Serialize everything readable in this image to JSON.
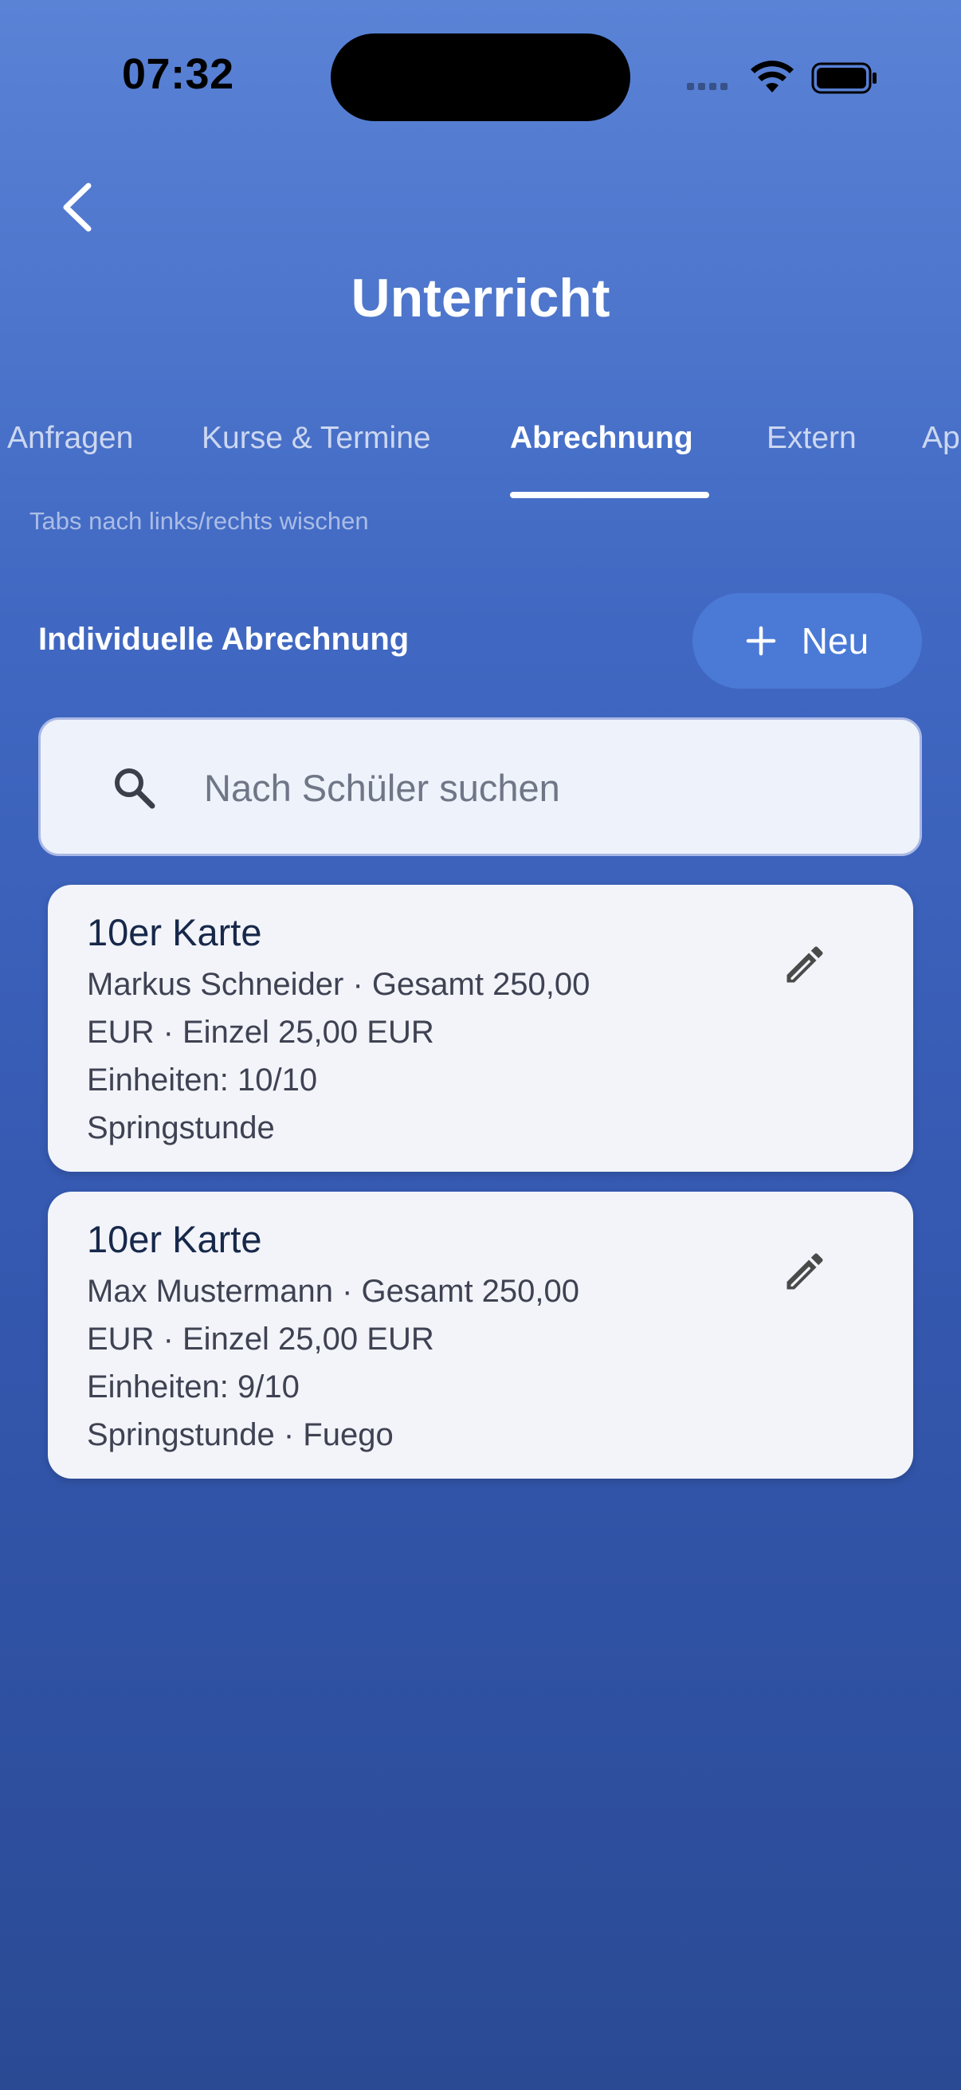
{
  "status_bar": {
    "time": "07:32"
  },
  "header": {
    "title": "Unterricht"
  },
  "tabs": [
    {
      "label": "Anfragen"
    },
    {
      "label": "Kurse & Termine"
    },
    {
      "label": "Abrechnung"
    },
    {
      "label": "Extern"
    },
    {
      "label": "Ap"
    }
  ],
  "tabs_hint": "Tabs nach links/rechts wischen",
  "section": {
    "title": "Individuelle Abrechnung",
    "new_button_label": "Neu"
  },
  "search": {
    "placeholder": "Nach Schüler suchen",
    "value": ""
  },
  "cards": [
    {
      "title": "10er Karte",
      "line1": "Markus Schneider · Gesamt 250,00",
      "line2": "EUR · Einzel 25,00 EUR",
      "line3": "Einheiten: 10/10",
      "line4": "Springstunde"
    },
    {
      "title": "10er Karte",
      "line1": "Max Mustermann · Gesamt 250,00",
      "line2": "EUR · Einzel 25,00 EUR",
      "line3": "Einheiten: 9/10",
      "line4": "Springstunde · Fuego"
    }
  ],
  "icons": {
    "back": "chevron-left-icon",
    "search": "search-icon",
    "edit": "pencil-icon",
    "add": "plus-icon"
  },
  "colors": {
    "accent": "#4b7ad6",
    "card_bg": "#f2f4f9",
    "search_bg": "#eef2fb"
  }
}
